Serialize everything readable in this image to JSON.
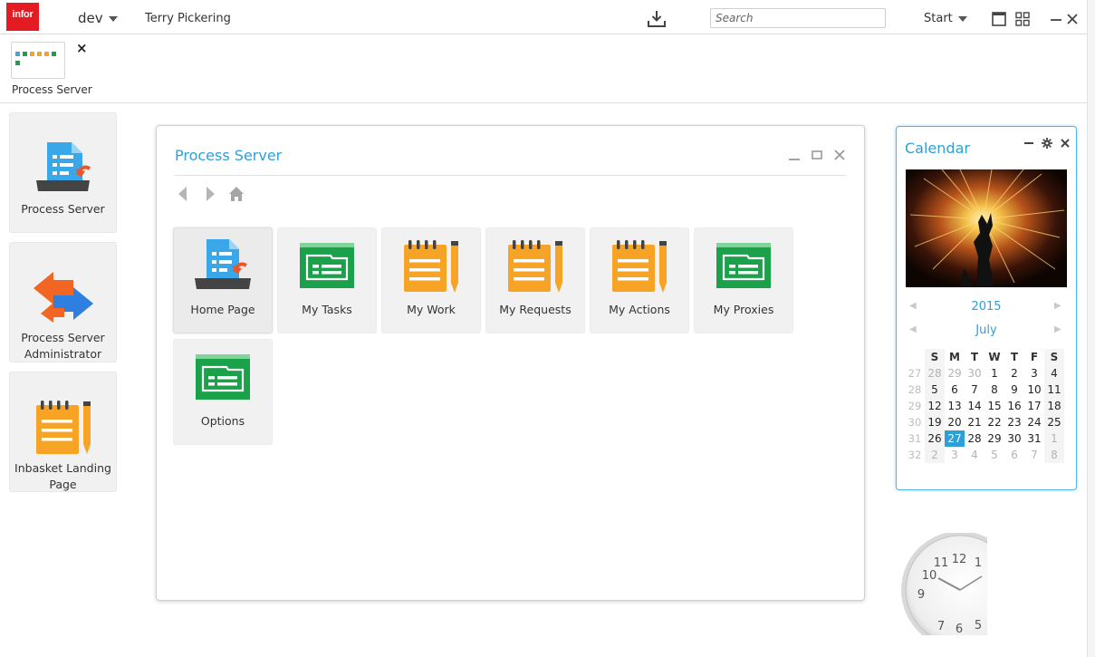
{
  "topbar": {
    "logo_text": "infor",
    "env_label": "dev",
    "user_name": "Terry Pickering",
    "search_placeholder": "Search",
    "start_label": "Start",
    "icons": [
      "download-icon",
      "window-icon",
      "grid-icon",
      "minimize-icon",
      "close-icon"
    ]
  },
  "pinned": {
    "label": "Process Server",
    "close": "×"
  },
  "launcher": [
    {
      "label": "Process Server",
      "icon": "document-tray-icon"
    },
    {
      "label": "Process Server Administrator",
      "icon": "swap-arrows-icon"
    },
    {
      "label": "Inbasket Landing Page",
      "icon": "notepad-icon"
    }
  ],
  "window": {
    "title": "Process Server",
    "tiles": [
      {
        "label": "Home Page",
        "icon": "document-tray-icon"
      },
      {
        "label": "My Tasks",
        "icon": "green-folder-icon"
      },
      {
        "label": "My Work",
        "icon": "notepad-icon"
      },
      {
        "label": "My Requests",
        "icon": "notepad-icon"
      },
      {
        "label": "My Actions",
        "icon": "notepad-icon"
      },
      {
        "label": "My Proxies",
        "icon": "green-folder-icon"
      },
      {
        "label": "Options",
        "icon": "green-folder-icon"
      }
    ]
  },
  "calendar": {
    "title": "Calendar",
    "year": "2015",
    "month": "July",
    "weekdays": [
      "S",
      "M",
      "T",
      "W",
      "T",
      "F",
      "S"
    ],
    "weeks": [
      {
        "wk": "27",
        "days": [
          "28",
          "29",
          "30",
          "1",
          "2",
          "3",
          "4"
        ],
        "muted": [
          true,
          true,
          true,
          false,
          false,
          false,
          false
        ]
      },
      {
        "wk": "28",
        "days": [
          "5",
          "6",
          "7",
          "8",
          "9",
          "10",
          "11"
        ],
        "muted": [
          false,
          false,
          false,
          false,
          false,
          false,
          false
        ]
      },
      {
        "wk": "29",
        "days": [
          "12",
          "13",
          "14",
          "15",
          "16",
          "17",
          "18"
        ],
        "muted": [
          false,
          false,
          false,
          false,
          false,
          false,
          false
        ]
      },
      {
        "wk": "30",
        "days": [
          "19",
          "20",
          "21",
          "22",
          "23",
          "24",
          "25"
        ],
        "muted": [
          false,
          false,
          false,
          false,
          false,
          false,
          false
        ]
      },
      {
        "wk": "31",
        "days": [
          "26",
          "27",
          "28",
          "29",
          "30",
          "31",
          "1"
        ],
        "muted": [
          false,
          false,
          false,
          false,
          false,
          false,
          true
        ]
      },
      {
        "wk": "32",
        "days": [
          "2",
          "3",
          "4",
          "5",
          "6",
          "7",
          "8"
        ],
        "muted": [
          true,
          true,
          true,
          true,
          true,
          true,
          true
        ]
      }
    ],
    "today": "27"
  },
  "clock": {
    "numerals": [
      "12",
      "1",
      "11",
      "10",
      "9",
      "7",
      "6",
      "5"
    ]
  },
  "colors": {
    "accent": "#2f9fd8",
    "logo": "#e31b23",
    "orange": "#f7a325",
    "green": "#1aa14a",
    "blue": "#3aa8e8"
  }
}
